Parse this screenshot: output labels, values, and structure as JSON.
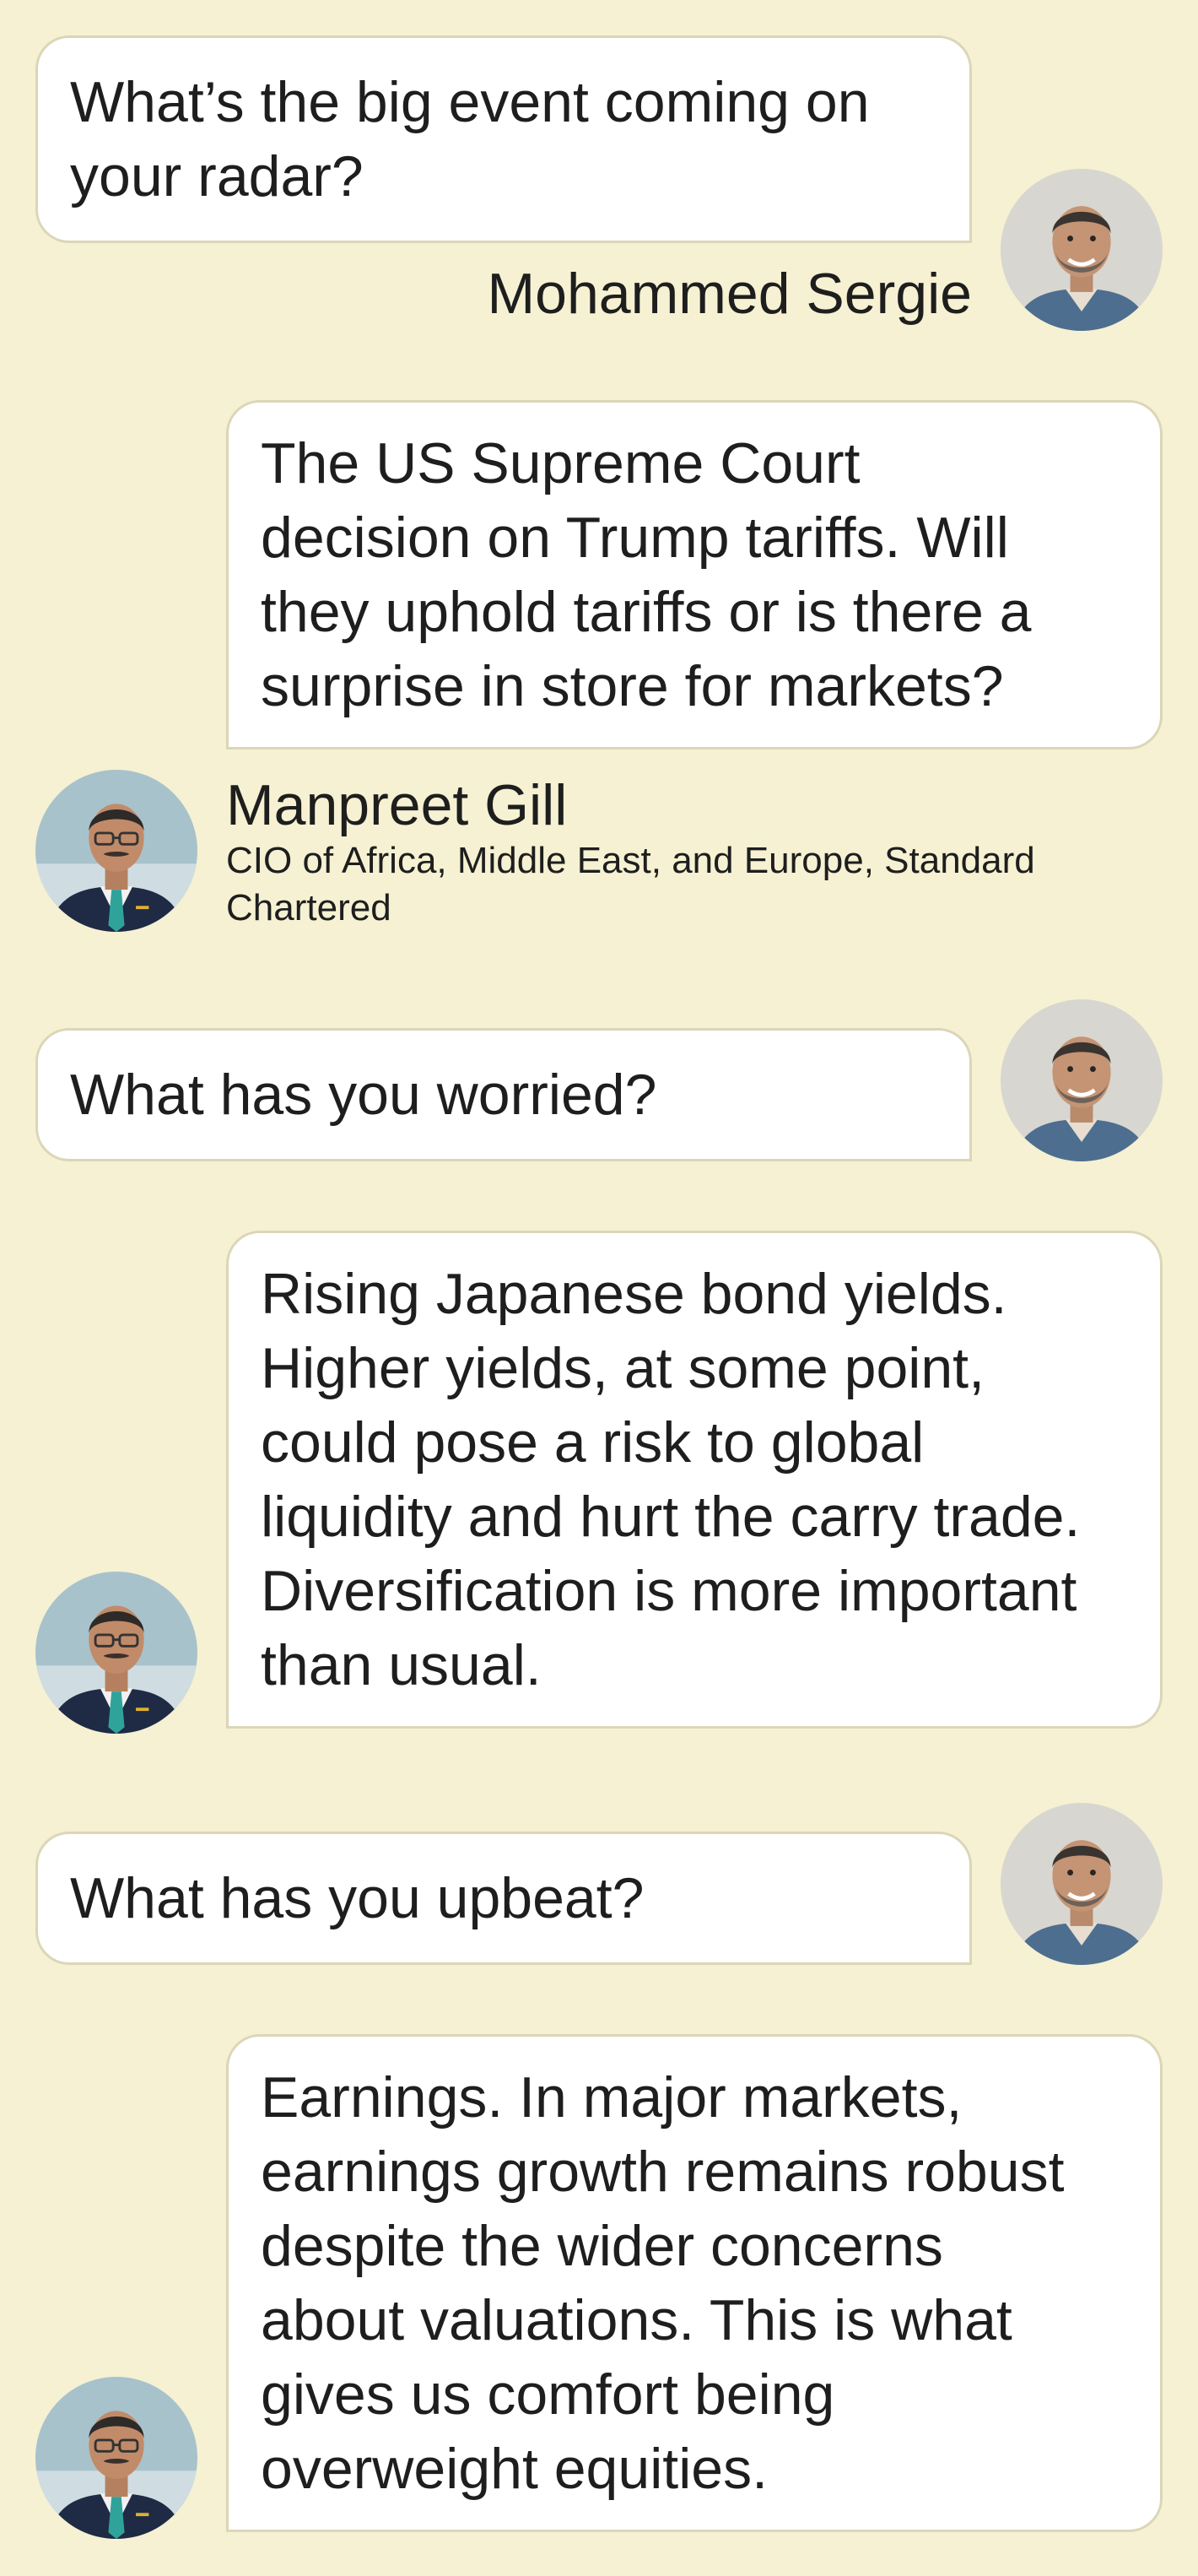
{
  "interviewer": {
    "name": "Mohammed Sergie",
    "avatar_icon": "portrait-man-avatar-icon"
  },
  "guest": {
    "name": "Manpreet Gill",
    "title": "CIO of Africa, Middle East, and Europe, Standard Chartered",
    "avatar_icon": "portrait-man-suit-avatar-icon"
  },
  "conversation": [
    {
      "speaker": "interviewer",
      "text": "What’s the big event coming on\nyour radar?"
    },
    {
      "speaker": "guest",
      "text": "The US Supreme Court\ndecision on Trump tariffs. Will\nthey uphold tariffs or is there a\nsurprise in store for markets?"
    },
    {
      "speaker": "interviewer",
      "text": "What has you worried?"
    },
    {
      "speaker": "guest",
      "text": "Rising Japanese bond yields.\nHigher yields, at some point,\ncould pose a risk to global\nliquidity and hurt the carry trade.\nDiversification is more important\nthan usual."
    },
    {
      "speaker": "interviewer",
      "text": "What has you upbeat?"
    },
    {
      "speaker": "guest",
      "text": "Earnings. In major markets,\nearnings growth remains robust\ndespite the wider concerns\nabout valuations. This is what\ngives us comfort being\noverweight equities."
    }
  ],
  "colors": {
    "background": "#f5f1d2",
    "bubble": "#ffffff",
    "bubble_border": "#dcd6b8",
    "text": "#1e1e1e"
  }
}
